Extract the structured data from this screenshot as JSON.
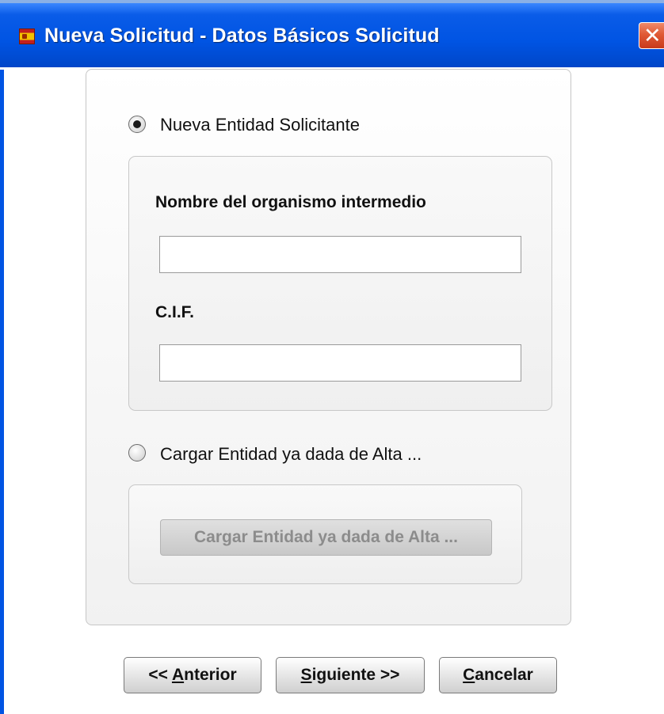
{
  "window": {
    "title": "Nueva Solicitud - Datos Básicos Solicitud",
    "close_glyph": "✕",
    "app_icon": "spain-flag-icon"
  },
  "options": {
    "new_entity": {
      "label": "Nueva Entidad Solicitante",
      "selected": true
    },
    "load_entity": {
      "label": "Cargar Entidad ya dada de Alta ...",
      "selected": false
    }
  },
  "form": {
    "org_label": "Nombre del organismo intermedio",
    "org_value": "",
    "cif_label": "C.I.F.",
    "cif_value": ""
  },
  "load_button": {
    "label": "Cargar Entidad ya dada de Alta ...",
    "enabled": false
  },
  "buttons": {
    "previous": {
      "prefix": "<< ",
      "mnemonic": "A",
      "rest": "nterior"
    },
    "next": {
      "prefix": "",
      "mnemonic": "S",
      "rest": "iguiente >>"
    },
    "cancel": {
      "prefix": "",
      "mnemonic": "C",
      "rest": "ancelar"
    }
  },
  "colors": {
    "title_bar": "#0054e3",
    "close_button": "#e05a35",
    "panel_border": "#c6c6c6"
  }
}
